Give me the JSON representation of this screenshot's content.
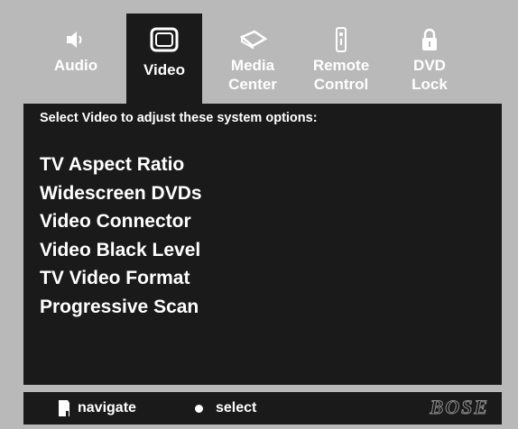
{
  "tabs": [
    {
      "label": "Audio",
      "icon": "speaker-icon",
      "active": false
    },
    {
      "label": "Video",
      "icon": "tv-icon",
      "active": true
    },
    {
      "label": "Media\nCenter",
      "icon": "media-center-icon",
      "active": false
    },
    {
      "label": "Remote\nControl",
      "icon": "remote-control-icon",
      "active": false
    },
    {
      "label": "DVD\nLock",
      "icon": "lock-icon",
      "active": false
    }
  ],
  "panel": {
    "heading": "Select Video to adjust these system options:",
    "options": [
      "TV Aspect Ratio",
      "Widescreen DVDs",
      "Video Connector",
      "Video Black Level",
      "TV Video Format",
      "Progressive Scan"
    ]
  },
  "footer": {
    "navigate_label": "navigate",
    "select_label": "select",
    "brand": "BOSE"
  },
  "colors": {
    "frame": "#b9b9b9",
    "panel": "#1a1a1a",
    "text": "#ffffff"
  }
}
